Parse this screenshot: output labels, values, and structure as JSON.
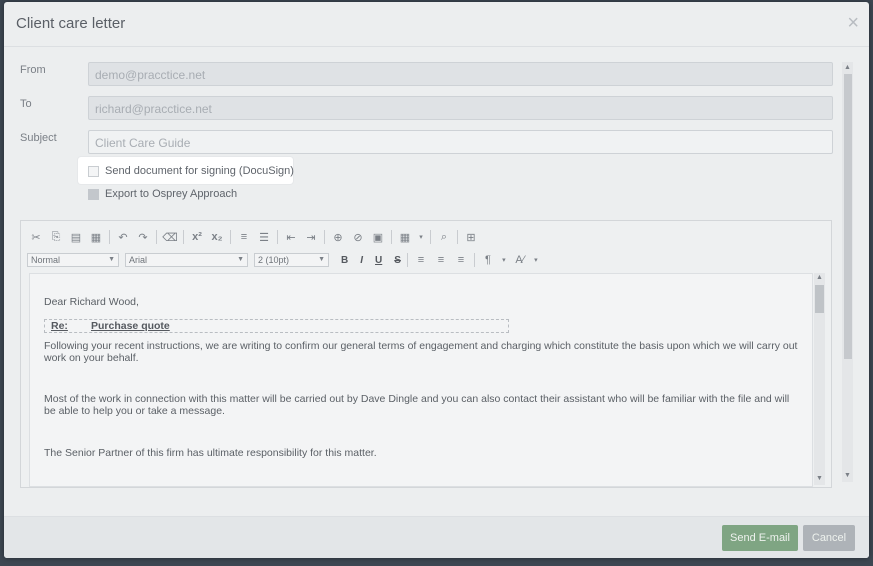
{
  "modal": {
    "title": "Client care letter",
    "close_symbol": "×"
  },
  "form": {
    "from_label": "From",
    "from_value": "demo@pracctice.net",
    "to_label": "To",
    "to_value": "richard@pracctice.net",
    "subject_label": "Subject",
    "subject_value": "Client Care Guide",
    "docusign_label": "Send document for signing (DocuSign)",
    "docusign_checked": false,
    "osprey_label": "Export to Osprey Approach",
    "osprey_checked": false
  },
  "editor": {
    "toolbar_icons": [
      "cut-icon",
      "copy-icon",
      "paste-icon",
      "paste-text-icon",
      "undo-icon",
      "redo-icon",
      "clear-format-icon",
      "superscript-icon",
      "subscript-icon",
      "numbered-list-icon",
      "bullet-list-icon",
      "outdent-icon",
      "indent-icon",
      "link-icon",
      "unlink-icon",
      "image-icon",
      "table-icon",
      "find-icon",
      "maximize-icon"
    ],
    "style_select": "Normal",
    "font_select": "Arial",
    "size_select": "2 (10pt)",
    "bold": "B",
    "italic": "I",
    "underline": "U",
    "strike": "S",
    "content": {
      "greeting": "Dear Richard Wood,",
      "re_label": "Re:",
      "re_value": "Purchase quote",
      "para1": "Following your recent instructions, we are writing to confirm our general terms of engagement and charging which constitute the basis upon which we will carry out work on your behalf.",
      "para2": "Most of the work in connection with this matter will be carried out by Dave Dingle and you can also contact their assistant who will be familiar with the file and will be able to help you or take a message.",
      "para3": "The Senior Partner of this firm has ultimate responsibility for this matter."
    }
  },
  "footer": {
    "send_label": "Send E-mail",
    "cancel_label": "Cancel"
  },
  "colors": {
    "send": "#7fa583",
    "cancel": "#aeb3b8",
    "backdrop": "#3d4752"
  }
}
